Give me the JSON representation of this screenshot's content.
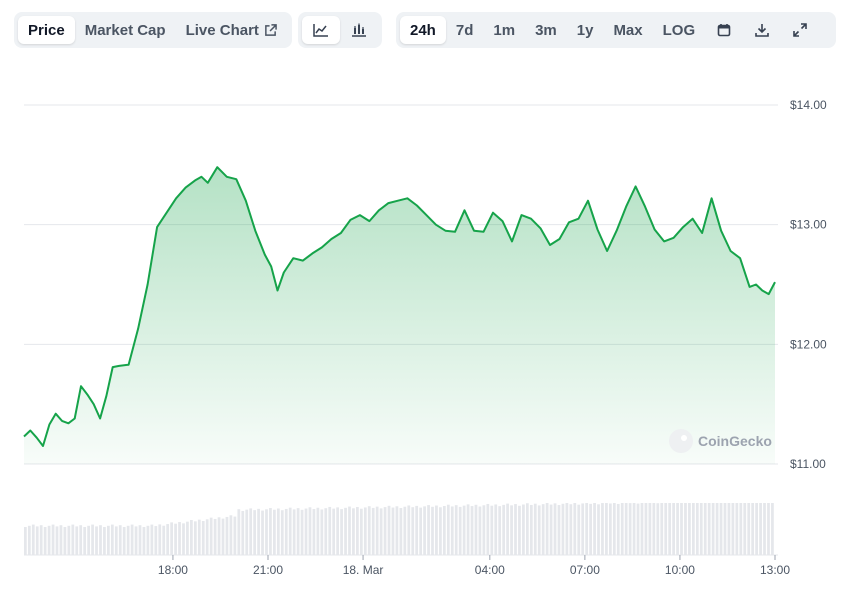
{
  "toolbar": {
    "view_tabs": [
      "Price",
      "Market Cap",
      "Live Chart"
    ],
    "active_view": "Price",
    "chart_type_icons": [
      "line-chart-icon",
      "candlestick-chart-icon"
    ],
    "ranges": [
      "24h",
      "7d",
      "1m",
      "3m",
      "1y",
      "Max",
      "LOG"
    ],
    "active_range": "24h",
    "action_icons": [
      "calendar-icon",
      "download-icon",
      "expand-icon"
    ]
  },
  "watermark": "CoinGecko",
  "colors": {
    "line": "#16a34a",
    "area_top": "#16a34a",
    "grid": "#e5e7eb",
    "volume": "#e5e7eb"
  },
  "chart_data": {
    "type": "area",
    "title": "",
    "xlabel": "",
    "ylabel": "",
    "ylim": [
      11.0,
      14.0
    ],
    "y_ticks": [
      "$14.00",
      "$13.00",
      "$12.00",
      "$11.00"
    ],
    "y_tick_values": [
      14,
      13,
      12,
      11
    ],
    "x_ticks": [
      "18:00",
      "21:00",
      "18. Mar",
      "04:00",
      "07:00",
      "10:00",
      "13:00"
    ],
    "x_tick_hours": [
      3,
      6,
      9,
      13,
      16,
      19,
      22
    ],
    "x_range_hours": [
      -1.7,
      22.0
    ],
    "grid": true,
    "series": [
      {
        "points": [
          [
            -1.7,
            11.23
          ],
          [
            -1.5,
            11.28
          ],
          [
            -1.3,
            11.22
          ],
          [
            -1.1,
            11.15
          ],
          [
            -0.9,
            11.33
          ],
          [
            -0.7,
            11.42
          ],
          [
            -0.5,
            11.36
          ],
          [
            -0.3,
            11.34
          ],
          [
            -0.1,
            11.38
          ],
          [
            0.1,
            11.65
          ],
          [
            0.3,
            11.58
          ],
          [
            0.5,
            11.5
          ],
          [
            0.7,
            11.38
          ],
          [
            0.9,
            11.57
          ],
          [
            1.1,
            11.81
          ],
          [
            1.3,
            11.82
          ],
          [
            1.6,
            11.83
          ],
          [
            1.9,
            12.13
          ],
          [
            2.2,
            12.5
          ],
          [
            2.5,
            12.98
          ],
          [
            2.8,
            13.1
          ],
          [
            3.1,
            13.22
          ],
          [
            3.4,
            13.31
          ],
          [
            3.7,
            13.37
          ],
          [
            3.9,
            13.4
          ],
          [
            4.1,
            13.35
          ],
          [
            4.4,
            13.48
          ],
          [
            4.7,
            13.4
          ],
          [
            5.0,
            13.38
          ],
          [
            5.3,
            13.2
          ],
          [
            5.6,
            12.95
          ],
          [
            5.9,
            12.75
          ],
          [
            6.1,
            12.65
          ],
          [
            6.3,
            12.45
          ],
          [
            6.5,
            12.6
          ],
          [
            6.8,
            12.72
          ],
          [
            7.1,
            12.7
          ],
          [
            7.4,
            12.76
          ],
          [
            7.7,
            12.81
          ],
          [
            8.0,
            12.88
          ],
          [
            8.3,
            12.93
          ],
          [
            8.6,
            13.04
          ],
          [
            8.9,
            13.08
          ],
          [
            9.2,
            13.03
          ],
          [
            9.5,
            13.12
          ],
          [
            9.8,
            13.18
          ],
          [
            10.1,
            13.2
          ],
          [
            10.4,
            13.22
          ],
          [
            10.7,
            13.16
          ],
          [
            11.0,
            13.08
          ],
          [
            11.3,
            13.0
          ],
          [
            11.6,
            12.95
          ],
          [
            11.9,
            12.94
          ],
          [
            12.2,
            13.12
          ],
          [
            12.5,
            12.95
          ],
          [
            12.8,
            12.94
          ],
          [
            13.1,
            13.1
          ],
          [
            13.4,
            13.03
          ],
          [
            13.7,
            12.86
          ],
          [
            14.0,
            13.08
          ],
          [
            14.3,
            13.05
          ],
          [
            14.6,
            12.97
          ],
          [
            14.9,
            12.83
          ],
          [
            15.2,
            12.88
          ],
          [
            15.5,
            13.02
          ],
          [
            15.8,
            13.05
          ],
          [
            16.1,
            13.2
          ],
          [
            16.4,
            12.96
          ],
          [
            16.7,
            12.78
          ],
          [
            17.0,
            12.95
          ],
          [
            17.3,
            13.15
          ],
          [
            17.6,
            13.32
          ],
          [
            17.9,
            13.15
          ],
          [
            18.2,
            12.96
          ],
          [
            18.5,
            12.86
          ],
          [
            18.8,
            12.89
          ],
          [
            19.1,
            12.98
          ],
          [
            19.4,
            13.05
          ],
          [
            19.7,
            12.93
          ],
          [
            20.0,
            13.22
          ],
          [
            20.3,
            12.95
          ],
          [
            20.6,
            12.78
          ],
          [
            20.9,
            12.72
          ],
          [
            21.2,
            12.48
          ],
          [
            21.4,
            12.5
          ],
          [
            21.6,
            12.45
          ],
          [
            21.8,
            12.42
          ],
          [
            22.0,
            12.52
          ]
        ]
      }
    ],
    "volume_bars": 190
  }
}
